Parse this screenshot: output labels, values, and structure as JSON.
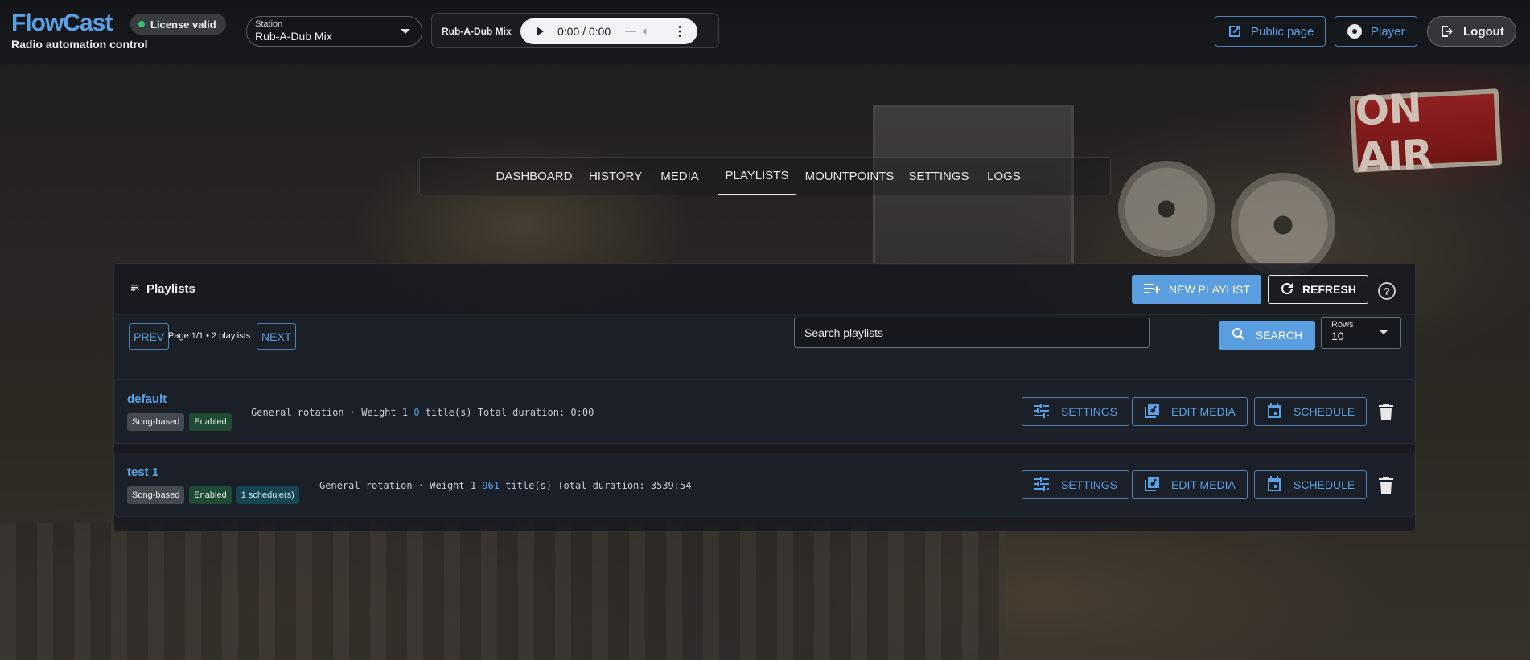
{
  "brand": {
    "name": "FlowCast",
    "subtitle": "Radio automation control"
  },
  "license": {
    "label": "License valid",
    "status_color": "#35c46a"
  },
  "station": {
    "label": "Station",
    "value": "Rub-A-Dub Mix"
  },
  "player": {
    "name": "Rub-A-Dub Mix",
    "time": "0:00 / 0:00"
  },
  "header_buttons": {
    "public_page": "Public page",
    "player": "Player",
    "logout": "Logout"
  },
  "nav": {
    "tabs": [
      "DASHBOARD",
      "HISTORY",
      "MEDIA",
      "PLAYLISTS",
      "MOUNTPOINTS",
      "SETTINGS",
      "LOGS"
    ],
    "active": "PLAYLISTS"
  },
  "background": {
    "sign_text": "ON AIR"
  },
  "panel": {
    "title": "Playlists",
    "new_playlist": "NEW PLAYLIST",
    "refresh": "REFRESH",
    "help": "?",
    "prev": "PREV",
    "next": "NEXT",
    "page_info": "Page 1/1 • 2 playlists",
    "search_placeholder": "Search playlists",
    "search_button": "SEARCH",
    "rows_label": "Rows",
    "rows_value": "10"
  },
  "playlists": [
    {
      "name": "default",
      "badges": [
        "Song-based",
        "Enabled"
      ],
      "meta_prefix": "General rotation · Weight 1",
      "count": "0",
      "meta_suffix": "title(s)",
      "duration": "Total duration: 0:00",
      "actions": [
        "SETTINGS",
        "EDIT MEDIA",
        "SCHEDULE"
      ]
    },
    {
      "name": "test 1",
      "badges": [
        "Song-based",
        "Enabled",
        "1 schedule(s)"
      ],
      "meta_prefix": "General rotation · Weight 1",
      "count": "961",
      "meta_suffix": "title(s)",
      "duration": "Total duration: 3539:54",
      "actions": [
        "SETTINGS",
        "EDIT MEDIA",
        "SCHEDULE"
      ]
    }
  ],
  "colors": {
    "accent": "#5aa0e6",
    "primary_button": "#5a9ee0",
    "enabled_badge": "#1f4a34",
    "schedule_badge": "#174452"
  }
}
